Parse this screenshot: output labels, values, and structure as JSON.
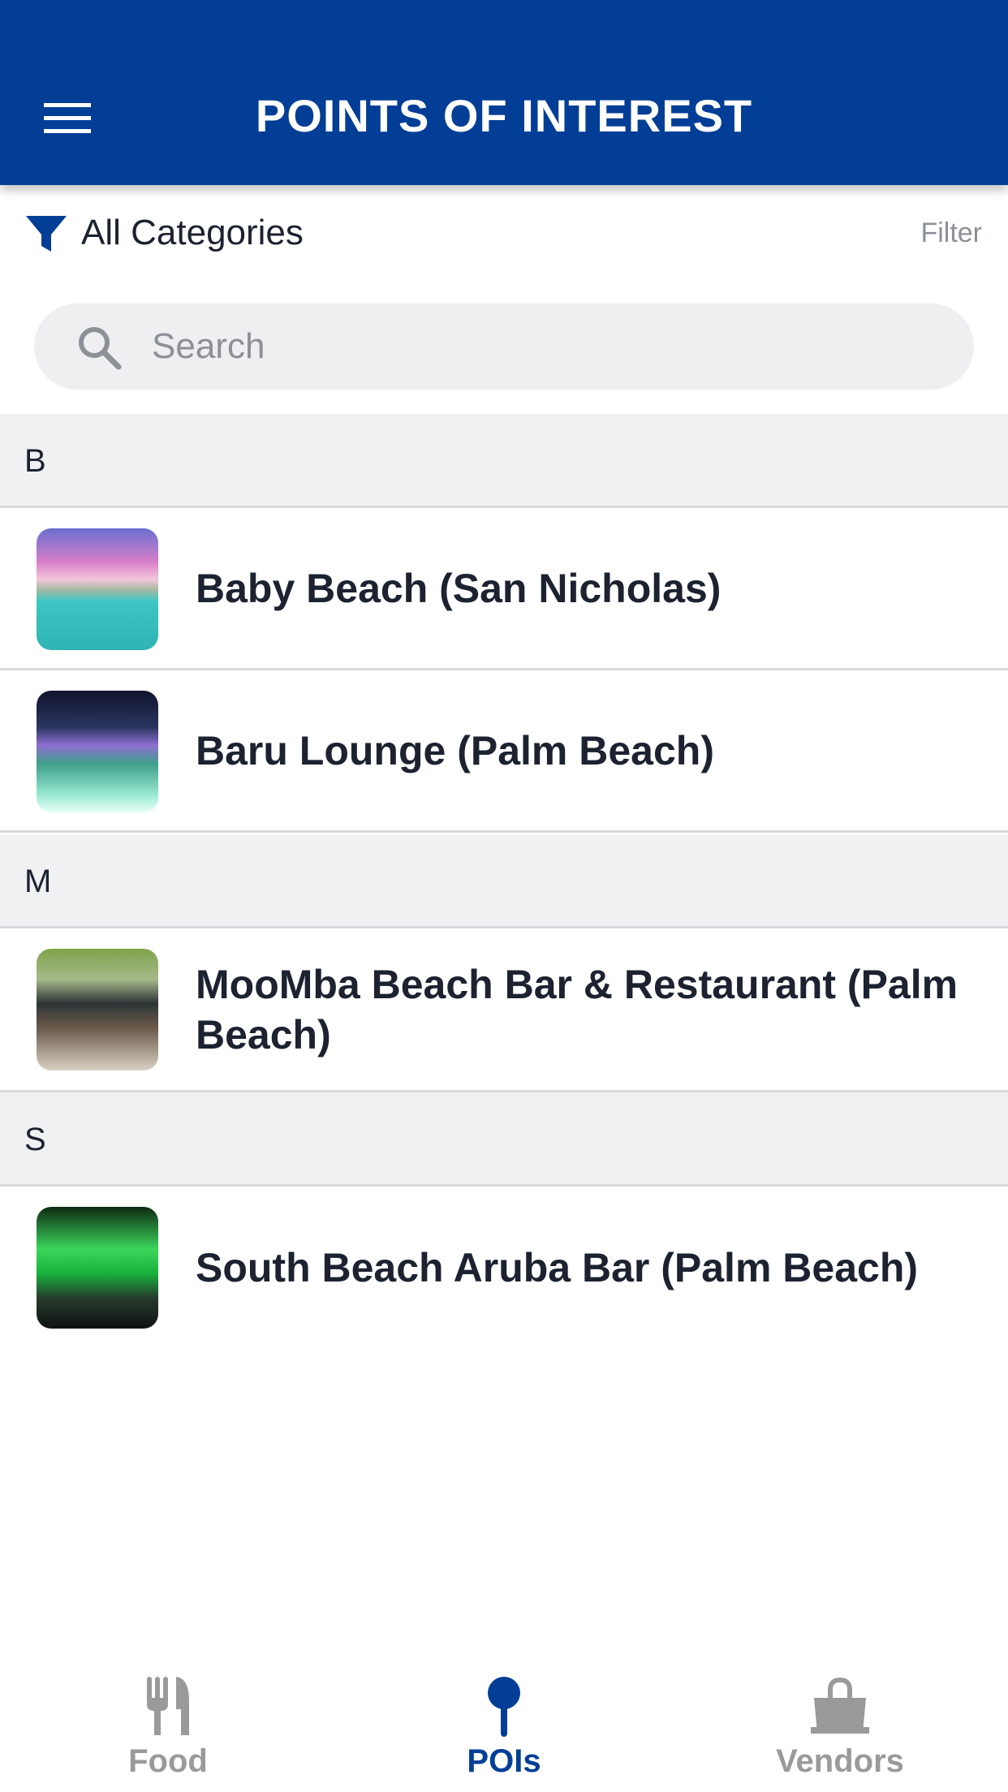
{
  "colors": {
    "primary": "#023e96",
    "tab_inactive": "#9a9a9a",
    "section_bg": "#f0f1f3"
  },
  "header": {
    "title": "POINTS OF INTEREST",
    "menu_icon": "hamburger-menu-icon"
  },
  "filter": {
    "icon": "funnel-filter-icon",
    "category": "All Categories",
    "action_label": "Filter"
  },
  "search": {
    "placeholder": "Search",
    "value": "",
    "icon": "search-icon"
  },
  "sections": [
    {
      "letter": "B",
      "items": [
        {
          "title": "Baby Beach (San Nicholas)"
        },
        {
          "title": "Baru Lounge (Palm Beach)"
        }
      ]
    },
    {
      "letter": "M",
      "items": [
        {
          "title": "MooMba Beach Bar & Restaurant (Palm Beach)"
        }
      ]
    },
    {
      "letter": "S",
      "items": [
        {
          "title": "South Beach Aruba Bar (Palm Beach)"
        }
      ]
    }
  ],
  "tabs": [
    {
      "label": "Food",
      "icon": "fork-knife-icon",
      "active": false
    },
    {
      "label": "POIs",
      "icon": "map-pin-icon",
      "active": true
    },
    {
      "label": "Vendors",
      "icon": "shopping-bag-icon",
      "active": false
    }
  ]
}
